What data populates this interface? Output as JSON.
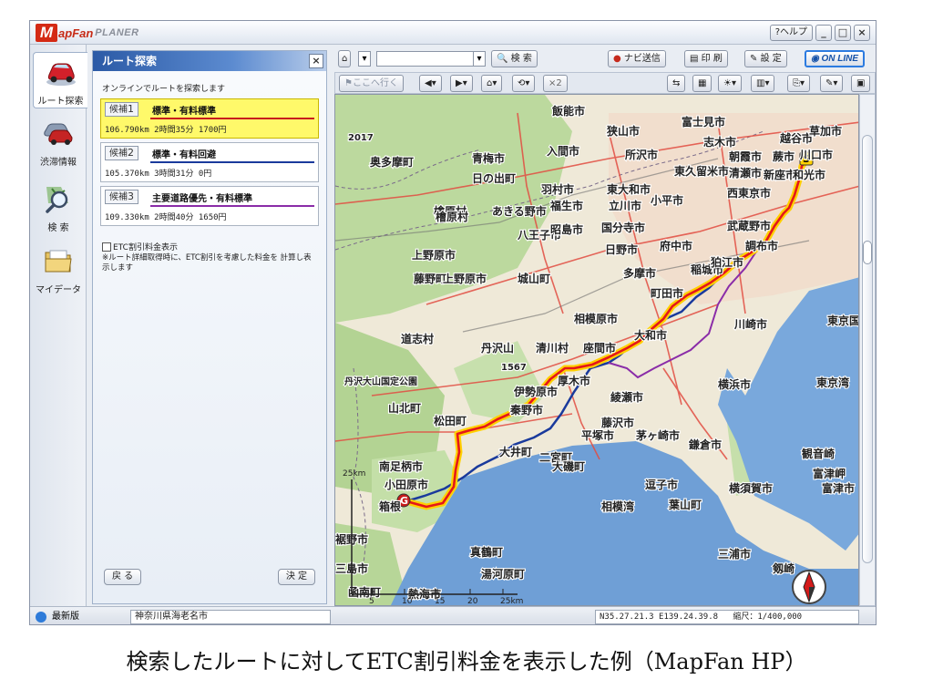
{
  "app": {
    "logo_mark": "M",
    "logo_text": "apFan",
    "logo_sub": "PLANER",
    "help_label": "?ヘルプ",
    "minimize_glyph": "_",
    "maximize_glyph": "□",
    "close_glyph": "×"
  },
  "left_tabs": [
    {
      "label": "ルート探索",
      "icon": "car-icon"
    },
    {
      "label": "渋滞情報",
      "icon": "traffic-jam-icon"
    },
    {
      "label": "検 索",
      "icon": "search-icon"
    },
    {
      "label": "マイデータ",
      "icon": "folder-icon"
    }
  ],
  "panel": {
    "title": "ルート探索",
    "close_glyph": "×",
    "intro": "オンラインでルートを探索します",
    "candidates": [
      {
        "tag_prefix": "候補",
        "tag_num": "1",
        "name": "標準・有料標準",
        "info": "106.790km  2時間35分  1700円",
        "line_color": "#c81c1c",
        "selected": true
      },
      {
        "tag_prefix": "候補",
        "tag_num": "2",
        "name": "標準・有料回避",
        "info": "105.370km  3時間31分  0円",
        "line_color": "#1a3a9c",
        "selected": false
      },
      {
        "tag_prefix": "候補",
        "tag_num": "3",
        "name": "主要道路優先・有料標準",
        "info": "109.330km  2時間40分  1650円",
        "line_color": "#8a2ca8",
        "selected": false
      }
    ],
    "etc_label": "ETC割引料金表示",
    "etc_note": "※ルート詳細取得時に、ETC割引を考慮した料金を 計算し表示します",
    "back_label": "戻 る",
    "decide_label": "決 定"
  },
  "toolbar": {
    "home_glyph": "⌂",
    "search_label": "検 索",
    "navi_send_label": "ナビ送信",
    "print_label": "印 刷",
    "settings_label": "設 定",
    "online_label": "ON LINE",
    "goto_label": "ここへ行く",
    "zoom_label": "×2"
  },
  "map": {
    "labels": [
      "飯能市",
      "狭山市",
      "富士見市",
      "志木市",
      "越谷市",
      "草加市",
      "奥多摩町",
      "青梅市",
      "入間市",
      "所沢市",
      "朝霞市",
      "蕨市",
      "川口市",
      "日の出町",
      "羽村市",
      "東大和市",
      "東久留米市",
      "清瀬市",
      "新座市",
      "和光市",
      "檜原村",
      "あきる野市",
      "福生市",
      "立川市",
      "小平市",
      "西東京市",
      "八王子市",
      "昭島市",
      "国分寺市",
      "武蔵野市",
      "上野原市",
      "日野市",
      "府中市",
      "調布市",
      "藤野町",
      "城山町",
      "多摩市",
      "稲城市",
      "狛江市",
      "町田市",
      "相模原市",
      "大和市",
      "川崎市",
      "東京国際",
      "道志村",
      "丹沢山",
      "清川村",
      "座間市",
      "1567",
      "丹沢大山国定公園",
      "厚木市",
      "横浜市",
      "東京湾",
      "伊勢原市",
      "綾瀬市",
      "山北町",
      "松田町",
      "秦野市",
      "藤沢市",
      "平塚市",
      "茅ヶ崎市",
      "鎌倉市",
      "大井町",
      "二宮町",
      "大磯町",
      "南足柄市",
      "小田原市",
      "逗子市",
      "葉山町",
      "横須賀市",
      "観音崎",
      "富津岬",
      "富津市",
      "相模湾",
      "箱根",
      "三浦市",
      "剱崎",
      "真鶴町",
      "湯河原町",
      "熱海市",
      "函南町",
      "裾野市",
      "三島市",
      "2017",
      "上野原市",
      "檜原村"
    ],
    "scale_labels": [
      "5",
      "10",
      "15",
      "20",
      "25km"
    ],
    "scale_side": "25km",
    "start_marker": "S",
    "goal_marker": "G"
  },
  "statusbar": {
    "latest_label": "最新版",
    "address": "神奈川県海老名市",
    "coords": "N35.27.21.3  E139.24.39.8",
    "scale": "縮尺：1/400,000"
  },
  "caption": "検索したルートに対してETC割引料金を表示した例（MapFan HP）",
  "colors": {
    "panel_header": "#2b5aa6",
    "selected_candidate": "#fff96a",
    "route_main": "#e4171a",
    "route_highlight": "#ffd000",
    "route_alt1": "#1a3a9c",
    "route_alt2": "#8a2ca8",
    "sea": "#6f9fd6",
    "land": "#efe9d8",
    "green": "#b8d79c"
  }
}
